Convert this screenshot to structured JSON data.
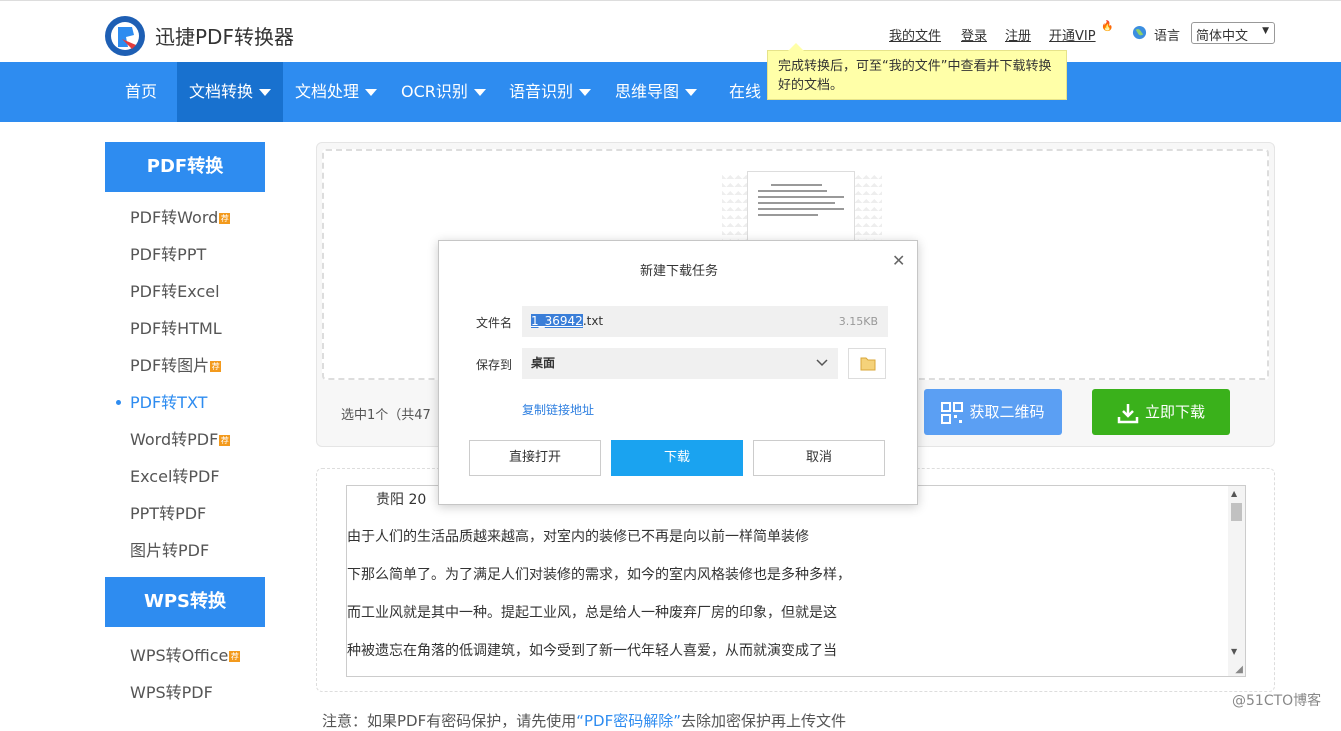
{
  "brand": {
    "name": "迅捷PDF转换器"
  },
  "top_links": {
    "my_files": "我的文件",
    "login": "登录",
    "register": "注册",
    "vip": "开通VIP",
    "language_label": "语言",
    "language_value": "简体中文"
  },
  "nav": {
    "items": [
      "首页",
      "文档转换",
      "文档处理",
      "OCR识别",
      "语音识别",
      "思维导图",
      "在线"
    ],
    "active": "文档转换"
  },
  "tooltip": {
    "text": "完成转换后，可至“我的文件”中查看并下载转换好的文档。"
  },
  "sidebar": {
    "pdf_header": "PDF转换",
    "pdf_items": [
      {
        "label": "PDF转Word",
        "vip": true
      },
      {
        "label": "PDF转PPT",
        "vip": false
      },
      {
        "label": "PDF转Excel",
        "vip": false
      },
      {
        "label": "PDF转HTML",
        "vip": false
      },
      {
        "label": "PDF转图片",
        "vip": true
      },
      {
        "label": "PDF转TXT",
        "vip": false,
        "active": true
      },
      {
        "label": "Word转PDF",
        "vip": true
      },
      {
        "label": "Excel转PDF",
        "vip": false
      },
      {
        "label": "PPT转PDF",
        "vip": false
      },
      {
        "label": "图片转PDF",
        "vip": false
      }
    ],
    "wps_header": "WPS转换",
    "wps_items": [
      {
        "label": "WPS转Office",
        "vip": true
      },
      {
        "label": "WPS转PDF",
        "vip": false
      }
    ],
    "vip_badge": "荐"
  },
  "panel": {
    "count_text": "选中1个（共47",
    "qr_button": "获取二维码",
    "download_button": "立即下载"
  },
  "preview": {
    "lines": [
      "贵阳      20",
      "  由于人们的生活品质越来越高，对室内的装修已不再是向以前一样简单装修",
      "下那么简单了。为了满足人们对装修的需求，如今的室内风格装修也是多种多样，",
      "而工业风就是其中一种。提起工业风，总是给人一种废弃厂房的印象，但就是这",
      "种被遗忘在角落的低调建筑，如今受到了新一代年轻人喜爱，从而就演变成了当"
    ]
  },
  "note": {
    "prefix": "注意：如果PDF有密码保护，请先使用",
    "link": "“PDF密码解除”",
    "suffix": "去除加密保护再上传文件"
  },
  "watermark": "@51CTO博客",
  "dialog": {
    "title": "新建下载任务",
    "filename_label": "文件名",
    "filename_selected": "1_36942",
    "filename_ext": ".txt",
    "file_size": "3.15KB",
    "save_label": "保存到",
    "save_location": "桌面",
    "copy_link": "复制链接地址",
    "open_button": "直接打开",
    "download_button": "下载",
    "cancel_button": "取消"
  },
  "colors": {
    "primary": "#2e8cf0",
    "nav_active": "#1871cf",
    "download_green": "#3ab11b",
    "vip_orange": "#f39a1d"
  }
}
